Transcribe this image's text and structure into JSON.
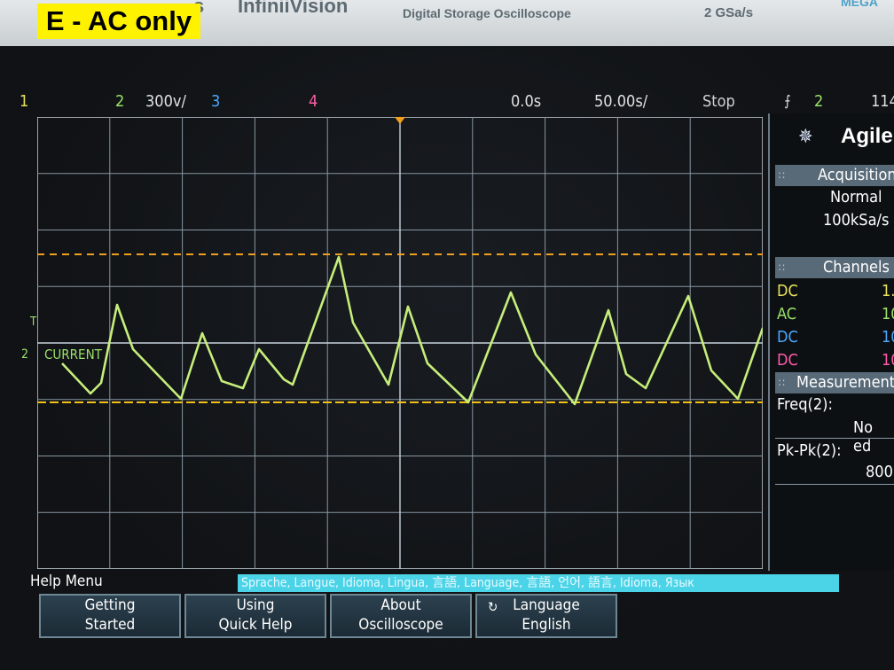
{
  "caption": "E - AC only",
  "bezel": {
    "brand_left": "s",
    "model": "InfiniiVision",
    "model_sub": "Digital Storage Oscilloscope",
    "rate": "2 GSa/s",
    "brand_right": "MEGA"
  },
  "status_bar": {
    "ch1": "1",
    "ch2": "2",
    "ch2_scale": "300v/",
    "ch3": "3",
    "ch4": "4",
    "time_delay": "0.0s",
    "time_scale": "50.00s/",
    "run_state": "Stop",
    "trigger_source": "2",
    "trigger_level": "114"
  },
  "waveform": {
    "channel_label": "CURRENT",
    "channel_marker": "2",
    "trigger_marker": "T",
    "color": "#c6ee7a",
    "cursor_upper_color": "#f0a020",
    "cursor_lower_color": "#f2c018"
  },
  "sidebar": {
    "brand": "Agile",
    "acquisition_title": "Acquisition",
    "acq_mode": "Normal",
    "acq_rate": "100kSa/s",
    "channels_title": "Channels",
    "channels": [
      {
        "coupling": "DC",
        "value": "1.",
        "color": "#e8e35a"
      },
      {
        "coupling": "AC",
        "value": "10",
        "color": "#9be36a"
      },
      {
        "coupling": "DC",
        "value": "10",
        "color": "#4aa8ff"
      },
      {
        "coupling": "DC",
        "value": "10",
        "color": "#ff5ca8"
      }
    ],
    "measurements_title": "Measurements",
    "freq_label": "Freq(2):",
    "freq_value": "No ed",
    "pkpk_label": "Pk-Pk(2):",
    "pkpk_value": "800"
  },
  "help_menu": {
    "title": "Help Menu",
    "language_strip": "Sprache, Langue, Idioma, Lingua, 言語, Language, 言語, 언어, 語言, Idioma, Язык",
    "softkeys": [
      {
        "line1": "Getting",
        "line2": "Started"
      },
      {
        "line1": "Using",
        "line2": "Quick Help"
      },
      {
        "line1": "About",
        "line2": "Oscilloscope"
      },
      {
        "line1": "Language",
        "line2": "English"
      }
    ]
  }
}
